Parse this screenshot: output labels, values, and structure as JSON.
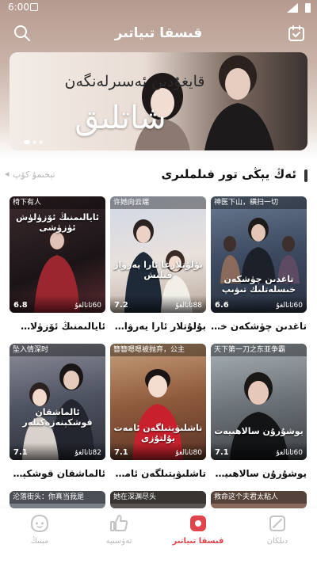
{
  "status": {
    "time": "6:00"
  },
  "header": {
    "title": "قىسقا تىياتىر"
  },
  "banner": {
    "subtitle": "قايغۇدىن ئەسىرلەنگەن",
    "title": "شاتلىق"
  },
  "section": {
    "title": "ئەڭ يېڭى تور فىلملىرى",
    "more_label": "تېخىمۇ كۆپ"
  },
  "dramas": [
    {
      "cn_title": "椅下有人",
      "poster_text": "ئايالىمنىڭ ئۆزۈلۈش ئۈزۈشى",
      "rating": "6.8",
      "episodes": "60ئاتالغۇ",
      "name": "ئايالىمنىڭ ئۆزۈلاش ئۈ..."
    },
    {
      "cn_title": "许她向云端",
      "poster_text": "بۇلۇتلارغا ئارا يەرۋاز قىلىش",
      "rating": "7.2",
      "episodes": "88ئاتالغۇ",
      "name": "بۇلۇتلار ئارا يەرۋاز قى..."
    },
    {
      "cn_title": "神医下山，横扫一切",
      "poster_text": "تاغدىن چۈشكەن خىسلەتلىك تىۋىپ",
      "rating": "6.6",
      "episodes": "60ئاتالغۇ",
      "name": "تاغدىن چۈشكەن خى..."
    },
    {
      "cn_title": "坠入情深时",
      "poster_text": "ئالماشقان قوشكېنەزەكىلەر",
      "rating": "7.1",
      "episodes": "82ئاتالغۇ",
      "name": "ئالماشقان قوشكېنەزەكلەر"
    },
    {
      "cn_title": "簪簪嗯嗯被抛弃，公主",
      "poster_text": "تاشلىۋېتىلگەن ئامەت يۇلتۇزى",
      "rating": "7.1",
      "episodes": "80ئاتالغۇ",
      "name": "تاشلىۋېتىلگەن ئامەت..."
    },
    {
      "cn_title": "天下第一刀之东亚争霸",
      "poster_text": "يوشۇرۇن سالاھىيەت",
      "rating": "7.1",
      "episodes": "60ئاتالغۇ",
      "name": "يوشۇرۇن سالاھىيەت"
    },
    {
      "cn_title": "沦落街头：你真当我是"
    },
    {
      "cn_title": "她在深渊尽头"
    },
    {
      "cn_title": "救命这个夫君太粘人"
    }
  ],
  "tabs": [
    {
      "label": "مېنىڭ",
      "icon": "profile-face-icon"
    },
    {
      "label": "تەۋسىيە",
      "icon": "thumbs-up-icon"
    },
    {
      "label": "قىسقا تىياتىر",
      "icon": "short-theater-icon"
    },
    {
      "label": "دىلكان",
      "icon": "discover-icon"
    }
  ],
  "colors": {
    "accent": "#e0454e",
    "inactive": "#bbbbbb"
  }
}
